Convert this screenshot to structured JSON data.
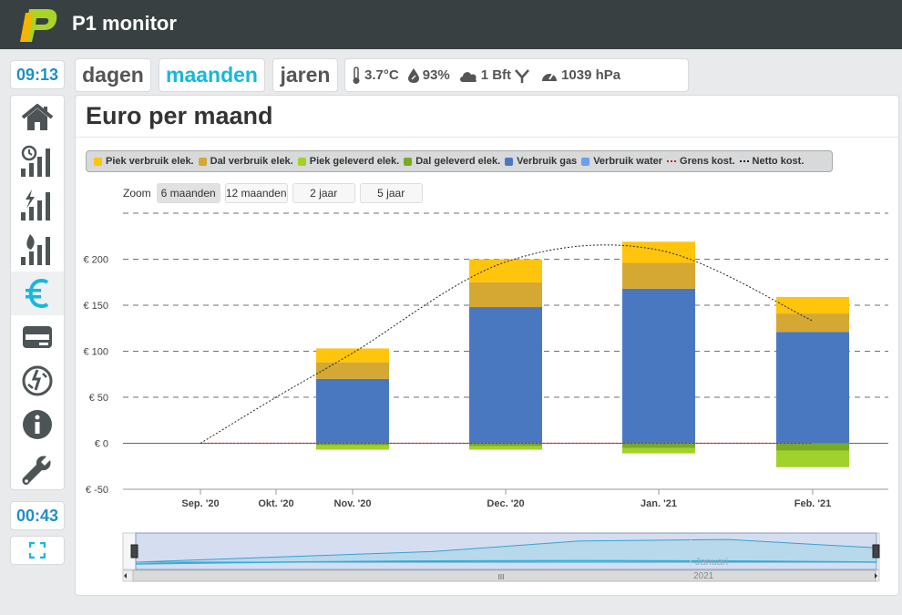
{
  "app": {
    "title": "P1 monitor"
  },
  "clock": {
    "time": "09:13",
    "timer": "00:43"
  },
  "tabs": [
    {
      "label": "dagen",
      "active": false
    },
    {
      "label": "maanden",
      "active": true
    },
    {
      "label": "jaren",
      "active": false
    }
  ],
  "weather": {
    "temperature": "3.7°C",
    "humidity": "93%",
    "wind": "1 Bft",
    "pressure": "1039 hPa"
  },
  "sidebar": {
    "items": [
      {
        "icon": "home-icon",
        "active": false
      },
      {
        "icon": "power-usage-icon",
        "active": false
      },
      {
        "icon": "power-flash-icon",
        "active": false
      },
      {
        "icon": "gas-flame-icon",
        "active": false
      },
      {
        "icon": "euro-icon",
        "active": true
      },
      {
        "icon": "meter-card-icon",
        "active": false
      },
      {
        "icon": "phase-icon",
        "active": false
      },
      {
        "icon": "info-icon",
        "active": false
      },
      {
        "icon": "wrench-icon",
        "active": false
      }
    ]
  },
  "page": {
    "title": "Euro per maand"
  },
  "colors": {
    "accent": "#17b8d8",
    "clock": "#1e8fc4",
    "piek_verbruik": "#ffc40c",
    "dal_verbruik": "#d4a833",
    "piek_geleverd": "#a0d22a",
    "dal_geleverd": "#78aa22",
    "verbruik_gas": "#4a78c0",
    "verbruik_water": "#6a9ef0",
    "grens": "#cc2222",
    "netto": "#222222"
  },
  "zoom": {
    "label": "Zoom",
    "options": [
      {
        "label": "6 maanden",
        "active": true
      },
      {
        "label": "12 maanden",
        "active": false
      },
      {
        "label": "2 jaar",
        "active": false
      },
      {
        "label": "5 jaar",
        "active": false
      }
    ]
  },
  "navigator": {
    "label_month": "Januari",
    "label_year": "2021",
    "scroll_grip": "III"
  },
  "chart_data": {
    "type": "bar",
    "stacked": true,
    "categories": [
      "Sep. '20",
      "Okt. '20",
      "Nov. '20",
      "Dec. '20",
      "Jan. '21",
      "Feb. '21"
    ],
    "ylim": [
      -50,
      250
    ],
    "ytick_values": [
      -50,
      0,
      50,
      100,
      150,
      200
    ],
    "ytick_labels": [
      "€ -50",
      "€ 0",
      "€ 50",
      "€ 100",
      "€ 150",
      "€ 200"
    ],
    "grid": "dashed",
    "legend_position": "top",
    "series": [
      {
        "name": "Piek verbruik elek.",
        "color_key": "piek_verbruik",
        "values": [
          0,
          0,
          15,
          25,
          23,
          18
        ]
      },
      {
        "name": "Dal verbruik elek.",
        "color_key": "dal_verbruik",
        "values": [
          0,
          0,
          18,
          27,
          28,
          20
        ]
      },
      {
        "name": "Piek geleverd elek.",
        "color_key": "piek_geleverd",
        "values": [
          0,
          0,
          -5,
          -4,
          -6,
          -18
        ]
      },
      {
        "name": "Dal geleverd elek.",
        "color_key": "dal_geleverd",
        "values": [
          0,
          0,
          -2,
          -3,
          -5,
          -8
        ]
      },
      {
        "name": "Verbruik gas",
        "color_key": "verbruik_gas",
        "values": [
          0,
          0,
          70,
          148,
          168,
          121
        ]
      },
      {
        "name": "Verbruik water",
        "color_key": "verbruik_water",
        "values": [
          0,
          0,
          0,
          0,
          0,
          0
        ]
      }
    ],
    "lines": [
      {
        "name": "Grens kost.",
        "color_key": "grens",
        "style": "dotted",
        "values": [
          0,
          0,
          0,
          0,
          0,
          0
        ]
      },
      {
        "name": "Netto kost.",
        "color_key": "netto",
        "style": "dotted",
        "values": [
          0,
          50,
          98,
          197,
          210,
          133
        ]
      }
    ]
  }
}
